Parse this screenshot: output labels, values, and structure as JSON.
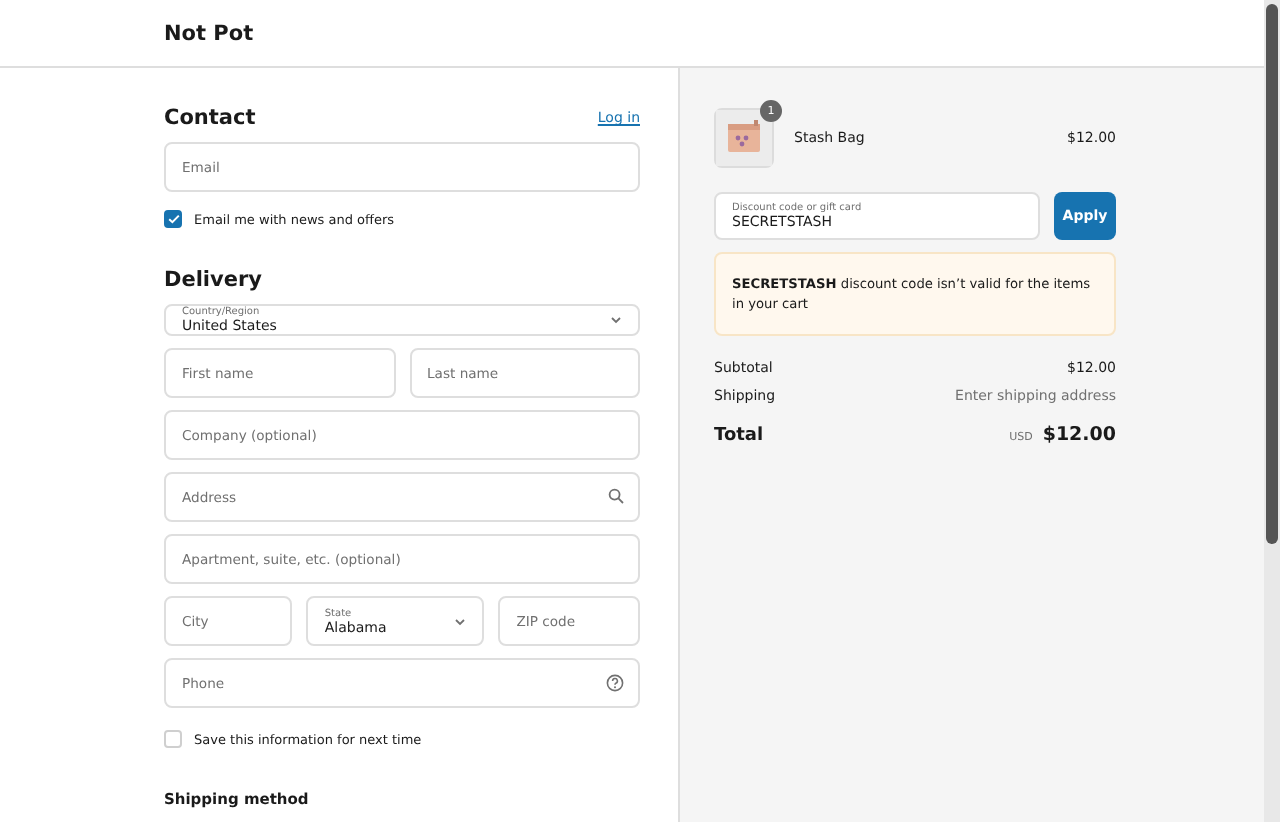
{
  "header": {
    "title": "Not Pot"
  },
  "contact": {
    "heading": "Contact",
    "login_link": "Log in",
    "email": {
      "placeholder": "Email"
    },
    "newsletter": {
      "label": "Email me with news and offers",
      "checked": true
    }
  },
  "delivery": {
    "heading": "Delivery",
    "country": {
      "label": "Country/Region",
      "value": "United States"
    },
    "first_name": {
      "placeholder": "First name"
    },
    "last_name": {
      "placeholder": "Last name"
    },
    "company": {
      "placeholder": "Company (optional)"
    },
    "address": {
      "placeholder": "Address"
    },
    "apartment": {
      "placeholder": "Apartment, suite, etc. (optional)"
    },
    "city": {
      "placeholder": "City"
    },
    "state": {
      "label": "State",
      "value": "Alabama"
    },
    "zip": {
      "placeholder": "ZIP code"
    },
    "phone": {
      "placeholder": "Phone"
    },
    "save_info": {
      "label": "Save this information for next time",
      "checked": false
    }
  },
  "shipping_method": {
    "heading": "Shipping method"
  },
  "summary": {
    "items": [
      {
        "kind": "picture",
        "quantity": "1",
        "name": "Stash Bag",
        "price": "$12.00"
      }
    ],
    "discount": {
      "label": "Discount code or gift card",
      "value": "SECRETSTASH",
      "button": "Apply"
    },
    "notice": "**SECRETSTASH** discount code isn’t valid for the items in your cart",
    "subtotal": {
      "label": "Subtotal",
      "value": "$12.00"
    },
    "shipping": {
      "label": "Shipping",
      "value": "Enter shipping address"
    },
    "total": {
      "label": "Total",
      "currency": "USD",
      "value": "$12.00"
    }
  }
}
